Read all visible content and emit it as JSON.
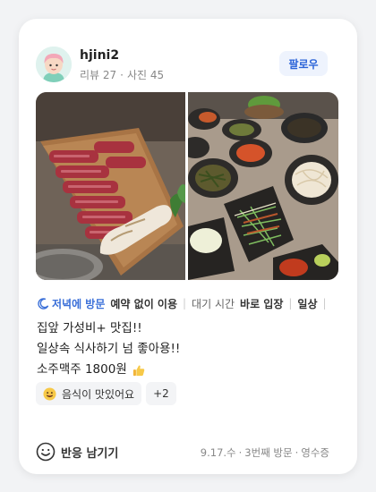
{
  "user": {
    "name": "hjini2",
    "reviews": "리뷰 27",
    "photos": "사진 45",
    "separator": "·"
  },
  "follow_label": "팔로우",
  "tags": {
    "visit_time": "저녁에 방문",
    "wait_prefix": "예약 없이 이용",
    "wait_label": "대기 시간",
    "wait_value": "바로 입장",
    "purpose": "일상",
    "separator": "|",
    "more": "…"
  },
  "review": {
    "lines": [
      "집앞 가성비+ 맛집!!",
      "일상속 식사하기 넘 좋아용!!",
      "소주맥주 1800원"
    ]
  },
  "chips": {
    "keyword": "음식이 맛있어요",
    "extra": "+2"
  },
  "footer": {
    "react_label": "반응 남기기",
    "date": "9.17.수",
    "visit_count": "3번째 방문",
    "proof": "영수증",
    "separator": "·"
  },
  "colors": {
    "accent": "#3a6fd8",
    "follow_bg": "#eef3fd",
    "chip_bg": "#f3f4f6"
  },
  "icons": {
    "visit_time": "moon-icon",
    "review_emoji": "thumbs-up-icon",
    "chip_emoji": "smiling-face-icon",
    "react": "smile-outline-icon"
  }
}
